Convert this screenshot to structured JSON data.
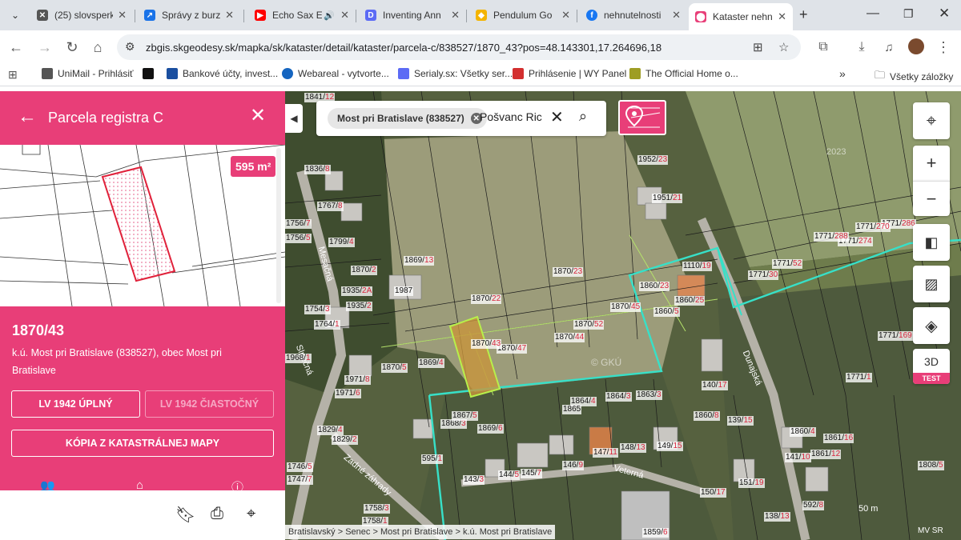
{
  "browser": {
    "tabs": [
      {
        "title": "(25) slovsperk",
        "favicon_color": "#555555",
        "icon": "x-logo-icon"
      },
      {
        "title": "Správy z burzy",
        "favicon_color": "#1a73e8",
        "icon": "chart-icon"
      },
      {
        "title": "Echo Sax E",
        "favicon_color": "#ff0000",
        "icon": "youtube-icon"
      },
      {
        "title": "Inventing Ann",
        "favicon_color": "#5c6bf5",
        "icon": "streaming-icon"
      },
      {
        "title": "Pendulum Go",
        "favicon_color": "#f4b400",
        "icon": "pendulum-icon"
      },
      {
        "title": "nehnutelnosti",
        "favicon_color": "#1877f2",
        "icon": "facebook-icon"
      },
      {
        "title": "Kataster nehn",
        "favicon_color": "#e83e78",
        "icon": "map-pin-icon",
        "active": true
      }
    ],
    "url": "zbgis.skgeodesy.sk/mapka/sk/kataster/detail/kataster/parcela-c/838527/1870_43?pos=48.143301,17.264696,18",
    "bookmarks": [
      {
        "label": "UniMail - Prihlásiť",
        "color": "#555555"
      },
      {
        "label": "",
        "color": "#111111"
      },
      {
        "label": "Bankové účty, invest...",
        "color": "#1a4fa0"
      },
      {
        "label": "Webareal - vytvorte...",
        "color": "#1565c0"
      },
      {
        "label": "Serialy.sx: Všetky ser...",
        "color": "#5c6bf5"
      },
      {
        "label": "Prihlásenie | WY Panel",
        "color": "#d32f2f"
      },
      {
        "label": "The Official Home o...",
        "color": "#9e9d24"
      }
    ],
    "all_bookmarks_label": "Všetky záložky"
  },
  "panel": {
    "header_title": "Parcela registra C",
    "area_badge": "595 m²",
    "parcel_number": "1870/43",
    "location": "k.ú. Most pri Bratislave (838527), obec Most pri Bratislave",
    "btn_lv_full": "LV 1942 ÚPLNÝ",
    "btn_lv_partial": "LV 1942 ČIASTOČNÝ",
    "btn_copy_map": "KÓPIA Z KATASTRÁLNEJ MAPY"
  },
  "map": {
    "search_chip": "Most pri Bratislave (838527)",
    "search_text": "Pošvanc Ric",
    "breadcrumb": "Bratislavský > Senec > Most pri Bratislave > k.ú. Most pri Bratislave",
    "btn_3d": "3D",
    "test_badge": "TEST",
    "scale": "50 m",
    "attribution": "MV SR",
    "watermark": "© GKÚ",
    "year_label": "2023",
    "streets": [
      "Mesačná",
      "Slnečná",
      "Dunajská",
      "Zadné záhrady",
      "Veterná"
    ],
    "parcel_labels": [
      "1841/12",
      "1836/8",
      "1767/8",
      "1756/7",
      "1756/5",
      "1799/4",
      "1870/2",
      "1869/13",
      "1987",
      "1935/2A",
      "1935/2",
      "1754/3",
      "1764/1",
      "1968/1",
      "1971/8",
      "1971/6",
      "1829/4",
      "1829/2",
      "1746/5",
      "1747/7",
      "1758/3",
      "1758/1",
      "1870/22",
      "1870/23",
      "1870/52",
      "1870/45",
      "1870/47",
      "1870/44",
      "1870/43",
      "1870/5",
      "1869/4",
      "1868/3",
      "1867/5",
      "1869/6",
      "1864/4",
      "1864/3",
      "1863/3",
      "1865",
      "1952/23",
      "1951/21",
      "1110/19",
      "1860/23",
      "1860/5",
      "1860/25",
      "1860/8",
      "140/17",
      "139/15",
      "149/15",
      "148/13",
      "147/11",
      "146/9",
      "145/7",
      "144/5",
      "143/3",
      "595/1",
      "150/17",
      "151/19",
      "138/13",
      "141/10",
      "1861/12",
      "592/8",
      "1808/5",
      "1771/1",
      "1771/286",
      "1771/270",
      "1771/274",
      "1771/288",
      "1771/52",
      "1771/30",
      "1859/6",
      "1860/4",
      "1861/16",
      "1771/169"
    ]
  }
}
